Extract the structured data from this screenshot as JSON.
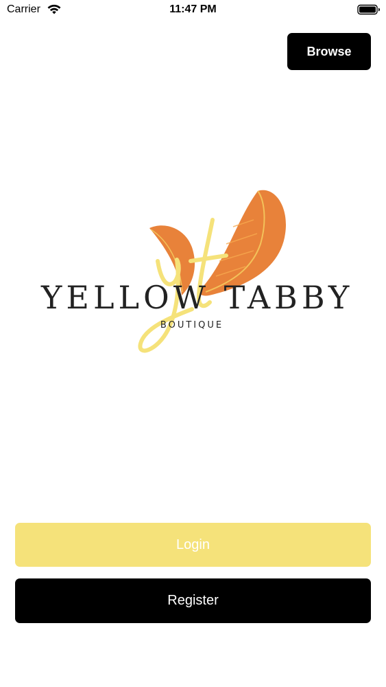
{
  "status_bar": {
    "carrier": "Carrier",
    "time": "11:47 PM",
    "wifi_icon": "wifi-icon",
    "battery_icon": "battery-icon"
  },
  "header": {
    "browse_label": "Browse"
  },
  "logo": {
    "brand_name": "YELLOW TABBY",
    "brand_subtitle": "BOUTIQUE",
    "monogram": "yt",
    "feather_icon": "feather-icon"
  },
  "actions": {
    "login_label": "Login",
    "register_label": "Register"
  },
  "colors": {
    "accent_yellow": "#f5e27a",
    "feather_orange": "#e8823a",
    "button_black": "#000000"
  }
}
